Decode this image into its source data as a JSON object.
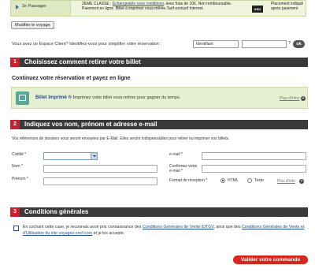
{
  "passenger": {
    "label": "2e Passager",
    "fare_lead": "2EME CLASSE :",
    "fare_link": "Echangeable sous conditions",
    "fare_rest": ", avec frais de 10€. Non remboursable. Paiement en ligne. Billet à imprimer vous-même.Tarif exclusif Internet.",
    "asd_badge": "ASD",
    "placement": "Placement indiqué après paiement"
  },
  "modify_button": "Modifier le voyage",
  "espace_client": {
    "prompt": "Vous avez un Espace Client? Identifiez-vous pour simplifier votre réservation :",
    "identifiant_value": "Identifiant",
    "help": "?",
    "ok": "ok"
  },
  "section1": {
    "number": "1",
    "title": "Choisissez comment retirer votre billet",
    "subtitle": "Continuez votre réservation et payez en ligne",
    "option_title": "Billet Imprimé ® :",
    "option_desc": "Imprimez votre billet vous-même pour gagner du temps.",
    "plus_info": "Plus d'infos",
    "plus_icon": "+"
  },
  "section2": {
    "number": "2",
    "title": "Indiquez vos nom, prénom et adresse e-mail",
    "note": "Vos références de dossiers vous seront envoyées par E-Mail. Elles seront indispensables pour retirer ou imprimer vos billets.",
    "civilite_label": "Civilité *",
    "nom_label": "Nom *",
    "prenom_label": "Prénom *",
    "email_label": "e-mail *",
    "confirm_label": "Confirmez votre e-mail *",
    "format_label": "Format de réception *",
    "format_html": "HTML",
    "format_texte": "Texte",
    "plus_info": "Plus d'info",
    "plus_icon": "+"
  },
  "section3": {
    "number": "3",
    "title": "Conditions générales",
    "text_a": "En cochant cette case, je reconnais avoir pris connaissance des ",
    "link_a": "Conditions Générales de Vente IDTGV",
    "text_b": ", ainsi que des ",
    "link_b": "Conditions Générales de Vente et d'Utilisation du site voyages-sncf.com",
    "text_c": " et je les accepte."
  },
  "validate_button": "Valider votre commande",
  "colors": {
    "section_bar": "#3a3a3a",
    "section_number": "#c8202f",
    "option_bg": "#e8f0d2",
    "validate": "#d9261c",
    "link": "#1f4e8c"
  }
}
